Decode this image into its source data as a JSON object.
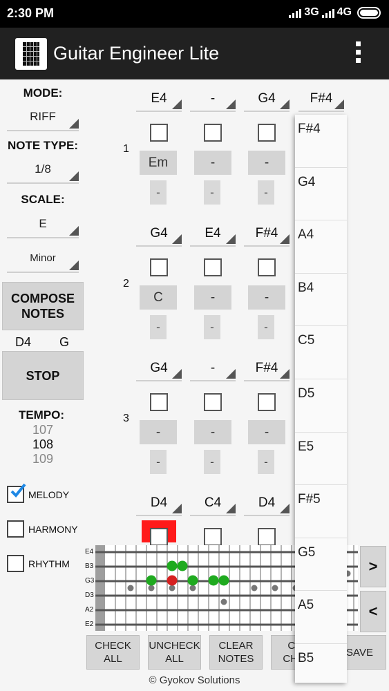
{
  "status": {
    "time": "2:30 PM",
    "net1": "3G",
    "net2": "4G"
  },
  "app": {
    "title": "Guitar Engineer Lite"
  },
  "left": {
    "mode_label": "MODE:",
    "mode_value": "RIFF",
    "note_type_label": "NOTE TYPE:",
    "note_type_value": "1/8",
    "scale_label": "SCALE:",
    "scale_root": "E",
    "scale_type": "Minor",
    "compose_label": "COMPOSE NOTES",
    "current_note": "D4",
    "current_chord": "G",
    "stop_label": "STOP",
    "tempo_label": "TEMPO:",
    "tempo_prev": "107",
    "tempo_value": "108",
    "tempo_next": "109",
    "melody_label": "MELODY",
    "melody_checked": true,
    "harmony_label": "HARMONY",
    "harmony_checked": false,
    "rhythm_label": "RHYTHM",
    "rhythm_checked": false
  },
  "grid": {
    "rows": [
      {
        "num": "1",
        "notes": [
          "E4",
          "-",
          "G4",
          "F#4"
        ],
        "chords": [
          "Em",
          "-",
          "-"
        ],
        "slots": [
          "-",
          "-",
          "-"
        ]
      },
      {
        "num": "2",
        "notes": [
          "G4",
          "E4",
          "F#4"
        ],
        "chords": [
          "C",
          "-",
          "-"
        ],
        "slots": [
          "-",
          "-",
          "-"
        ]
      },
      {
        "num": "3",
        "notes": [
          "G4",
          "-",
          "F#4"
        ],
        "chords": [
          "-",
          "-",
          "-"
        ],
        "slots": [
          "-",
          "-",
          "-"
        ]
      },
      {
        "num": "",
        "notes": [
          "D4",
          "C4",
          "D4"
        ]
      }
    ]
  },
  "fretboard": {
    "strings": [
      "E4",
      "B3",
      "G3",
      "D3",
      "A2",
      "E2"
    ]
  },
  "buttons": {
    "check_all": "CHECK ALL",
    "uncheck_all": "UNCHECK ALL",
    "clear_notes": "CLEAR NOTES",
    "clear_chords": "CL CHO",
    "save": "SAVE",
    "next": ">",
    "prev": "<"
  },
  "dropdown": {
    "options": [
      "F#4",
      "G4",
      "A4",
      "B4",
      "C5",
      "D5",
      "E5",
      "F#5",
      "G5",
      "A5",
      "B5"
    ]
  },
  "footer": "© Gyokov Solutions",
  "colors": {
    "accent_check": "#1e88e5",
    "active_note": "#2ca02c",
    "current_note": "#d62020",
    "active_cell": "#ff1a1a"
  }
}
